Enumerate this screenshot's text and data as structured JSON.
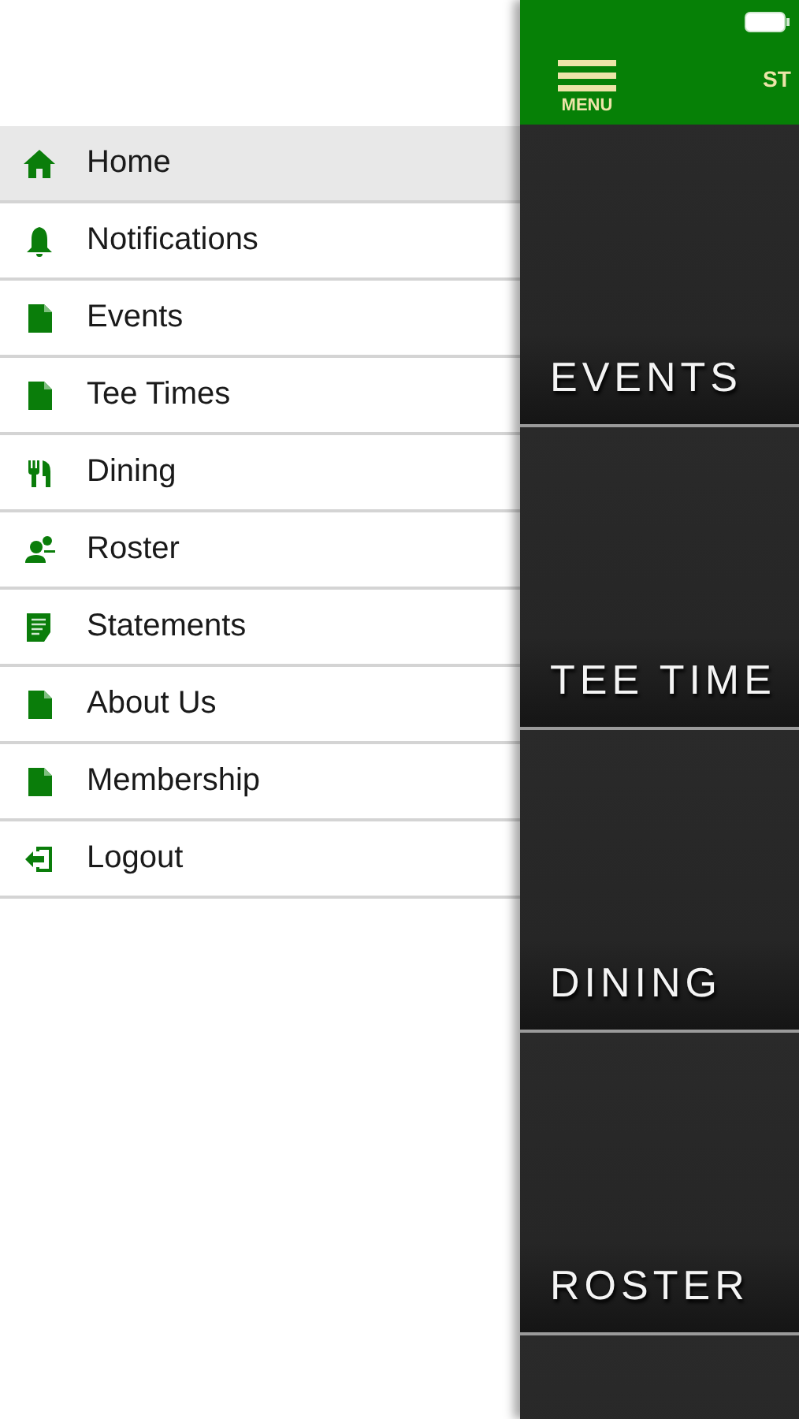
{
  "menu": {
    "items": [
      {
        "label": "Home",
        "kind": "home",
        "selected": true
      },
      {
        "label": "Notifications",
        "kind": "bell",
        "selected": false
      },
      {
        "label": "Events",
        "kind": "page",
        "selected": false
      },
      {
        "label": "Tee Times",
        "kind": "page",
        "selected": false
      },
      {
        "label": "Dining",
        "kind": "dining",
        "selected": false
      },
      {
        "label": "Roster",
        "kind": "people",
        "selected": false
      },
      {
        "label": "Statements",
        "kind": "statement",
        "selected": false
      },
      {
        "label": "About Us",
        "kind": "page",
        "selected": false
      },
      {
        "label": "Membership",
        "kind": "page",
        "selected": false
      },
      {
        "label": "Logout",
        "kind": "logout",
        "selected": false
      }
    ]
  },
  "header": {
    "menu_label": "MENU",
    "title": "ST"
  },
  "tiles": [
    {
      "label": "EVENTS"
    },
    {
      "label": "TEE TIME"
    },
    {
      "label": "DINING"
    },
    {
      "label": "ROSTER"
    }
  ]
}
